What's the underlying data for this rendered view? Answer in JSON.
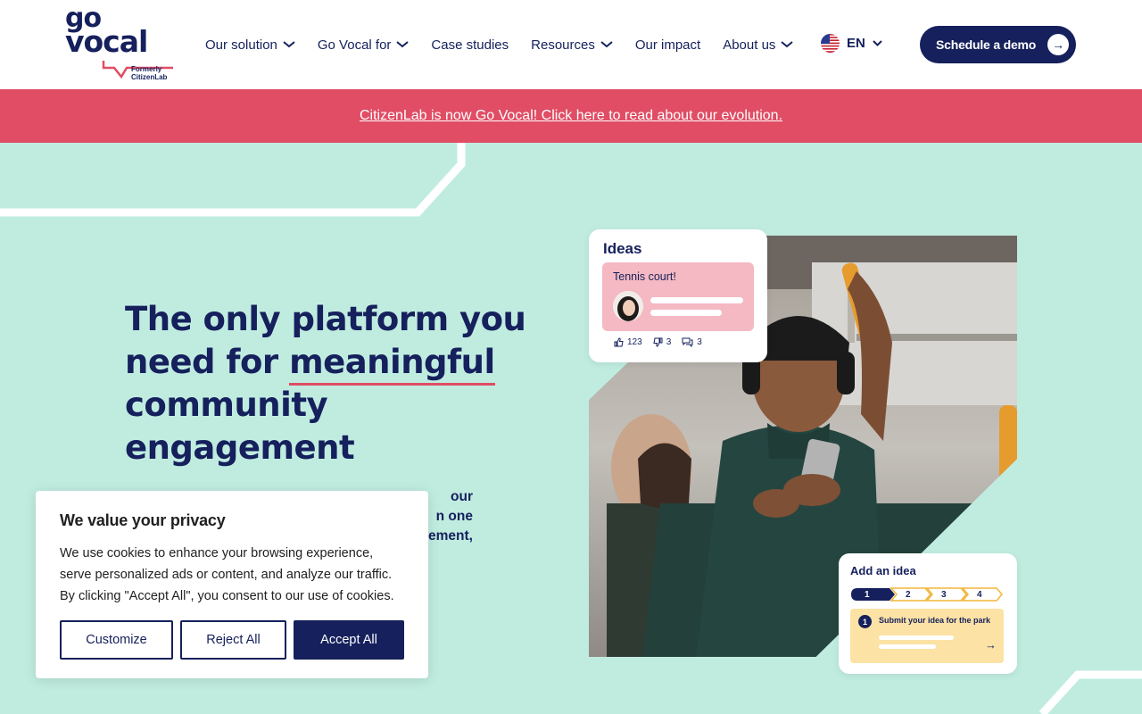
{
  "header": {
    "logo": {
      "line1": "go",
      "line2": "vocal",
      "tagline1": "Formerly",
      "tagline2": "CitizenLab"
    },
    "nav": [
      {
        "label": "Our solution",
        "has_dropdown": true
      },
      {
        "label": "Go Vocal for",
        "has_dropdown": true
      },
      {
        "label": "Case studies",
        "has_dropdown": false
      },
      {
        "label": "Resources",
        "has_dropdown": true
      },
      {
        "label": "Our impact",
        "has_dropdown": false
      },
      {
        "label": "About us",
        "has_dropdown": true
      }
    ],
    "language": {
      "code": "EN",
      "icon": "us-flag-icon"
    },
    "cta_label": "Schedule a demo"
  },
  "banner": {
    "text": "CitizenLab is now Go Vocal! Click here to read about our evolution."
  },
  "hero": {
    "title_part1": "The only platform you need for",
    "title_highlight": "meaningful",
    "title_part2": "community engagement",
    "subtitle_lines": [
      "our",
      "n one",
      "ement,"
    ]
  },
  "ideas_card": {
    "title": "Ideas",
    "idea_label": "Tennis court!",
    "upvotes": "123",
    "downvotes": "3",
    "comments": "3"
  },
  "add_card": {
    "title": "Add an idea",
    "steps": [
      "1",
      "2",
      "3",
      "4"
    ],
    "step_number": "1",
    "step_text": "Submit your idea for the park"
  },
  "cookie": {
    "title": "We value your privacy",
    "body": "We use cookies to enhance your browsing experience, serve personalized ads or content, and analyze our traffic. By clicking \"Accept All\", you consent to our use of cookies.",
    "buttons": {
      "customize": "Customize",
      "reject": "Reject All",
      "accept": "Accept All"
    }
  },
  "colors": {
    "navy": "#15205c",
    "brand_red": "#e04d64",
    "mint_background": "#c0ece0",
    "idea_pink": "#f4b9c2",
    "step_yellow": "#fce2a4"
  }
}
